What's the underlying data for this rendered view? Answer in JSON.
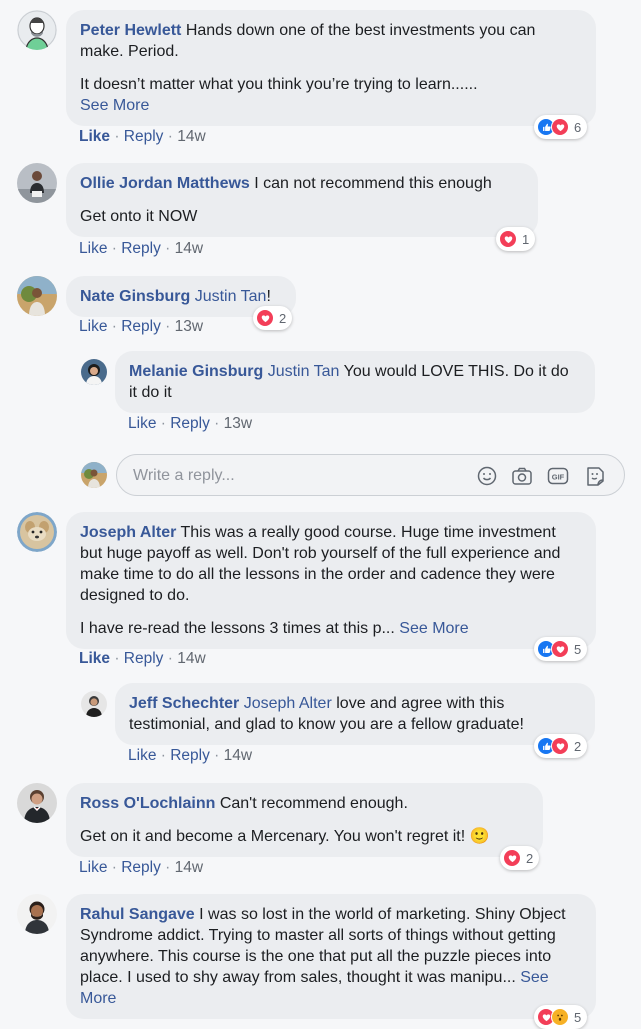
{
  "comments": [
    {
      "author": "Peter Hewlett",
      "text1": "Hands down one of the best investments you can make. Period.",
      "text2": "It doesn’t matter what you think you’re trying to learn......",
      "see_more": "See More",
      "like": "Like",
      "reply": "Reply",
      "time": "14w",
      "reactions": [
        "like",
        "love"
      ],
      "reaction_count": "6"
    },
    {
      "author": "Ollie Jordan Matthews",
      "text1": "I can not recommend this enough",
      "text2": "Get onto it NOW",
      "like": "Like",
      "reply": "Reply",
      "time": "14w",
      "reactions": [
        "love"
      ],
      "reaction_count": "1"
    },
    {
      "author": "Nate Ginsburg",
      "mention": "Justin Tan",
      "text1": "!",
      "like": "Like",
      "reply": "Reply",
      "time": "13w",
      "reactions": [
        "love"
      ],
      "reaction_count": "2",
      "replies": [
        {
          "author": "Melanie Ginsburg",
          "mention": "Justin Tan",
          "text1": "You would LOVE THIS. Do it do it do it",
          "like": "Like",
          "reply": "Reply",
          "time": "13w"
        }
      ]
    },
    {
      "author": "Joseph Alter",
      "text1": "This was a really good course. Huge time investment but huge payoff as well. Don't rob yourself of the full experience and make time to do all the lessons in the order and cadence they were designed to do.",
      "text2": "I have re-read the lessons 3 times at this p...",
      "see_more": "See More",
      "like": "Like",
      "reply": "Reply",
      "time": "14w",
      "reactions": [
        "like",
        "love"
      ],
      "reaction_count": "5",
      "replies": [
        {
          "author": "Jeff Schechter",
          "mention": "Joseph Alter",
          "text1": "love and agree with this testimonial, and glad to know you are a fellow graduate!",
          "like": "Like",
          "reply": "Reply",
          "time": "14w",
          "reactions": [
            "like",
            "love"
          ],
          "reaction_count": "2"
        }
      ]
    },
    {
      "author": "Ross O'Lochlainn",
      "text1": "Can't recommend enough.",
      "text2": "Get on it and become a Mercenary. You won't regret it! 🙂",
      "like": "Like",
      "reply": "Reply",
      "time": "14w",
      "reactions": [
        "love"
      ],
      "reaction_count": "2"
    },
    {
      "author": "Rahul Sangave",
      "text1": "I was so lost in the world of marketing. Shiny Object Syndrome addict. Trying to master all sorts of things without getting anywhere. This course is the one that put all the puzzle pieces into place. I used to shy away from sales, thought it was manipu...",
      "see_more": "See More",
      "reactions": [
        "love",
        "wow"
      ],
      "reaction_count": "5"
    }
  ],
  "reply_box": {
    "placeholder": "Write a reply...",
    "gif_label": "GIF"
  },
  "colors": {
    "link": "#385898",
    "bubble": "#ebedf0",
    "like_blue": "#1877f2",
    "love_red": "#f33e58"
  },
  "icons": [
    "like-reaction-icon",
    "love-reaction-icon",
    "wow-reaction-icon",
    "emoji-icon",
    "camera-icon",
    "gif-icon",
    "sticker-icon"
  ]
}
